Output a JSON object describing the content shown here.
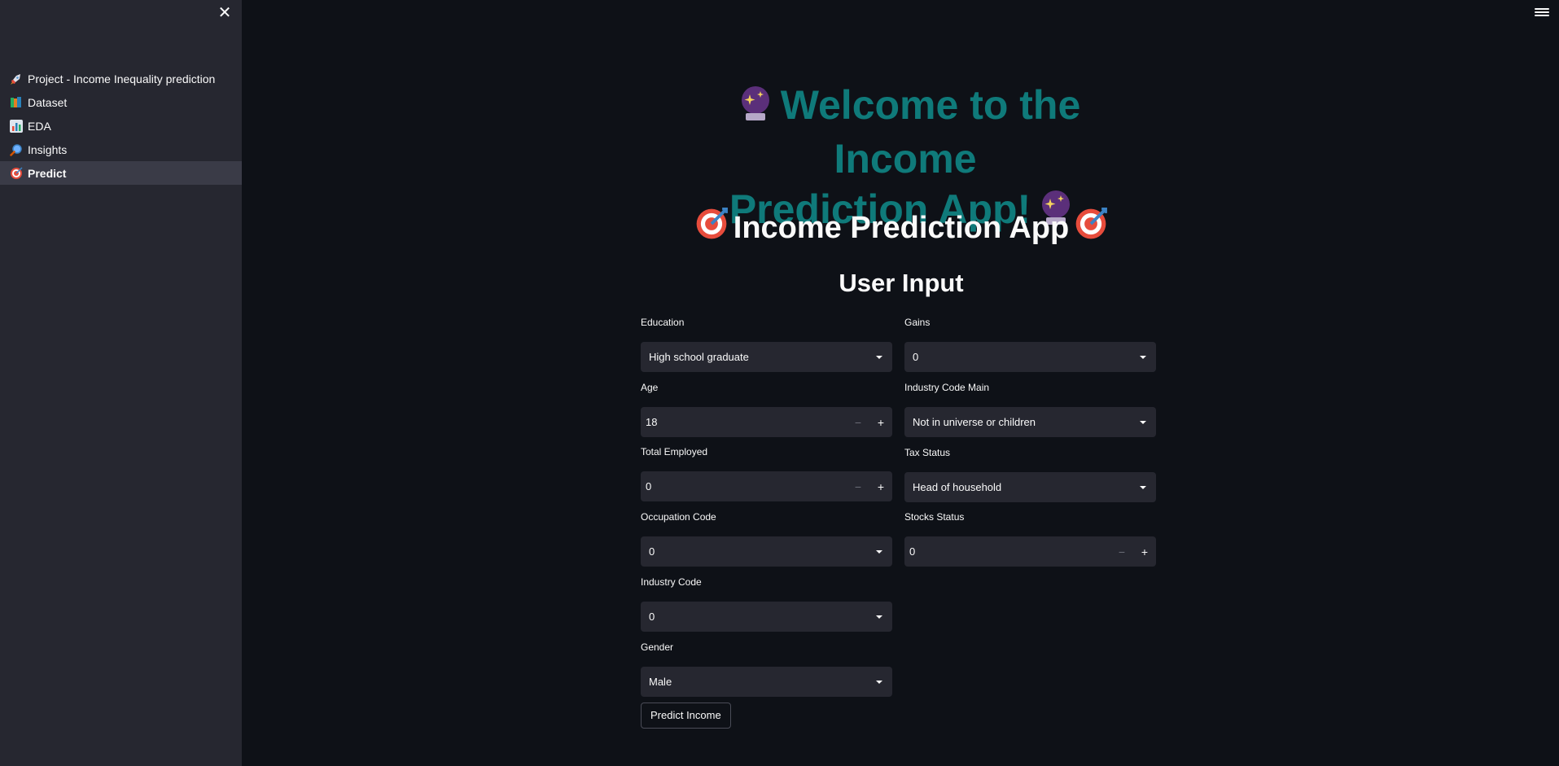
{
  "sidebar": {
    "items": [
      {
        "label": "Project - Income Inequality prediction",
        "icon": "rocket-icon"
      },
      {
        "label": "Dataset",
        "icon": "books-icon"
      },
      {
        "label": "EDA",
        "icon": "bar-chart-icon"
      },
      {
        "label": "Insights",
        "icon": "magnifier-icon"
      },
      {
        "label": "Predict",
        "icon": "target-icon",
        "active": true
      }
    ]
  },
  "main": {
    "welcome_line1": "Welcome to the Income",
    "welcome_line2": "Prediction App!",
    "app_title": "Income Prediction App",
    "section_title": "User Input"
  },
  "form": {
    "education": {
      "label": "Education",
      "value": "High school graduate"
    },
    "age": {
      "label": "Age",
      "value": "18"
    },
    "total_employed": {
      "label": "Total Employed",
      "value": "0"
    },
    "occupation_code": {
      "label": "Occupation Code",
      "value": "0"
    },
    "industry_code": {
      "label": "Industry Code",
      "value": "0"
    },
    "gender": {
      "label": "Gender",
      "value": "Male"
    },
    "gains": {
      "label": "Gains",
      "value": "0"
    },
    "industry_code_main": {
      "label": "Industry Code Main",
      "value": "Not in universe or children"
    },
    "tax_status": {
      "label": "Tax Status",
      "value": "Head of household"
    },
    "stocks_status": {
      "label": "Stocks Status",
      "value": "0"
    },
    "submit_label": "Predict Income"
  },
  "colors": {
    "background": "#0e1117",
    "sidebar": "#262730",
    "welcome_text": "#0f7a7a"
  }
}
